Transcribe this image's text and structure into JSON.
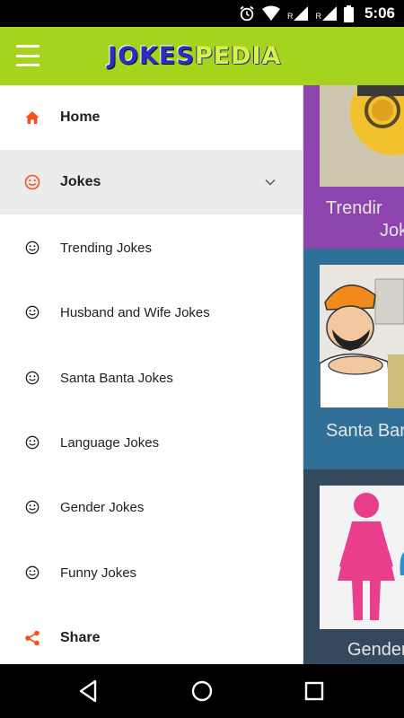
{
  "status_bar": {
    "time": "5:06",
    "network_label": "R"
  },
  "app_bar": {
    "logo_part1": "JOKES",
    "logo_part2": "PEDIA"
  },
  "drawer": {
    "items": [
      {
        "label": "Home",
        "icon": "home-icon"
      },
      {
        "label": "Jokes",
        "icon": "smiley-icon"
      },
      {
        "label": "Trending Jokes",
        "icon": "smiley-icon"
      },
      {
        "label": "Husband and Wife Jokes",
        "icon": "smiley-icon"
      },
      {
        "label": "Santa Banta Jokes",
        "icon": "smiley-icon"
      },
      {
        "label": "Language Jokes",
        "icon": "smiley-icon"
      },
      {
        "label": "Gender Jokes",
        "icon": "smiley-icon"
      },
      {
        "label": "Funny Jokes",
        "icon": "smiley-icon"
      },
      {
        "label": "Share",
        "icon": "share-icon"
      }
    ]
  },
  "content": {
    "cards": [
      {
        "title_line1": "Trendir",
        "title_line2": "Jok",
        "bg": "#8e44ad"
      },
      {
        "title": "Santa Bar",
        "bg": "#2f6f98"
      },
      {
        "title": "Gender",
        "bg": "#34495e"
      }
    ]
  },
  "colors": {
    "accent": "#f4511e",
    "app_bar": "#a6d31d",
    "drawer_active_bg": "#ebebeb"
  }
}
